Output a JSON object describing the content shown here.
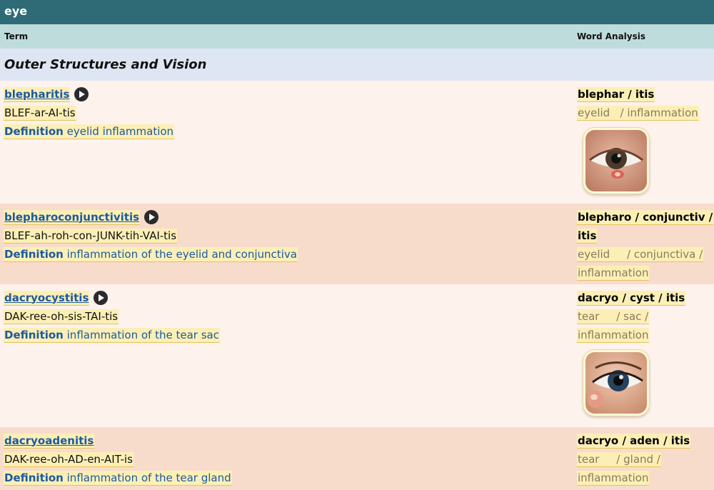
{
  "header": {
    "title": "eye"
  },
  "columns": {
    "term": "Term",
    "analysis": "Word Analysis"
  },
  "section": {
    "title": "Outer Structures and Vision"
  },
  "definition_label": "Definition",
  "entries": [
    {
      "term": "blepharitis",
      "pronunciation": "BLEF-ar-AI-tis",
      "definition": "eyelid inflammation",
      "analysis_lines": [
        "blephar / itis"
      ],
      "meaning_lines": [
        "eyelid   / inflammation"
      ],
      "has_audio": true,
      "has_image": true,
      "image_icon": "inflamed-eyelid-photo"
    },
    {
      "term": "blepharoconjunctivitis",
      "pronunciation": "BLEF-ah-roh-con-JUNK-tih-VAI-tis",
      "definition": "inflammation of the eyelid and conjunctiva",
      "analysis_lines": [
        "blepharo / conjunctiv /",
        "itis"
      ],
      "meaning_lines": [
        "eyelid     / conjunctiva /",
        "inflammation"
      ],
      "has_audio": true,
      "has_image": false
    },
    {
      "term": "dacryocystitis",
      "pronunciation": "DAK-ree-oh-sis-TAI-tis",
      "definition": "inflammation of the tear sac",
      "analysis_lines": [
        "dacryo / cyst / itis"
      ],
      "meaning_lines": [
        "tear     / sac /",
        "inflammation"
      ],
      "has_audio": true,
      "has_image": true,
      "image_icon": "tear-sac-eye-illustration"
    },
    {
      "term": "dacryoadenitis",
      "pronunciation": "DAK-ree-oh-AD-en-AIT-is",
      "definition": "inflammation of the tear gland",
      "analysis_lines": [
        "dacryo / aden / itis"
      ],
      "meaning_lines": [
        "tear     / gland /",
        "inflammation"
      ],
      "has_audio": false,
      "has_image": false
    }
  ]
}
